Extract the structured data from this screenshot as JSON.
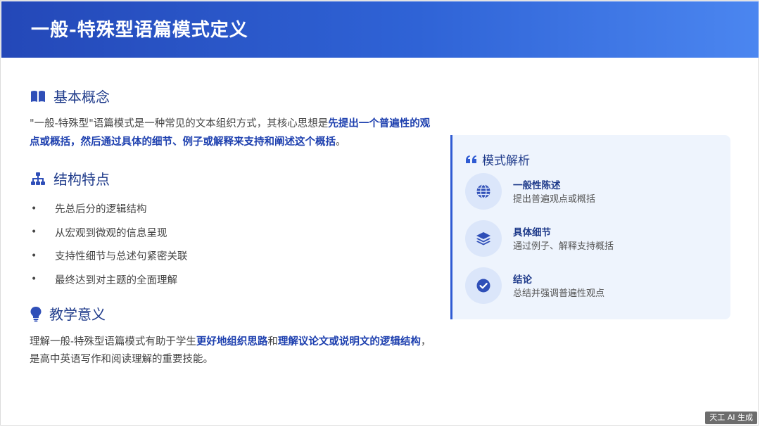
{
  "header": {
    "title": "一般-特殊型语篇模式定义"
  },
  "concept": {
    "title": "基本概念",
    "icon": "open-book-icon",
    "text_pre": "\"一般-特殊型\"语篇模式是一种常见的文本组织方式，其核心思想是",
    "text_hl": "先提出一个普遍性的观点或概括，然后通过具体的细节、例子或解释来支持和阐述这个概括",
    "text_post": "。"
  },
  "structure": {
    "title": "结构特点",
    "icon": "hierarchy-icon",
    "items": [
      {
        "label": "先总后分的逻辑结构"
      },
      {
        "label": "从宏观到微观的信息呈现"
      },
      {
        "label": "支持性细节与总述句紧密关联"
      },
      {
        "label": "最终达到对主题的全面理解"
      }
    ],
    "bullet": "•"
  },
  "teaching": {
    "title": "教学意义",
    "icon": "lightbulb-icon",
    "text_pre": "理解一般-特殊型语篇模式有助于学生",
    "text_hl1": "更好地组织思路",
    "text_mid": "和",
    "text_hl2": "理解议论文或说明文的逻辑结构",
    "text_post": "，是高中英语写作和阅读理解的重要技能。"
  },
  "panel": {
    "title": "模式解析",
    "icon": "quote-icon",
    "items": [
      {
        "title": "一般性陈述",
        "desc": "提出普遍观点或概括",
        "icon": "globe-icon"
      },
      {
        "title": "具体细节",
        "desc": "通过例子、解释支持概括",
        "icon": "layers-icon"
      },
      {
        "title": "结论",
        "desc": "总结并强调普遍性观点",
        "icon": "check-circle-icon"
      }
    ]
  },
  "watermark": {
    "label": "天工 AI 生成"
  },
  "colors": {
    "accent": "#2f5bd3",
    "heading": "#1e3a8a",
    "panel_bg": "#eef4fd"
  }
}
